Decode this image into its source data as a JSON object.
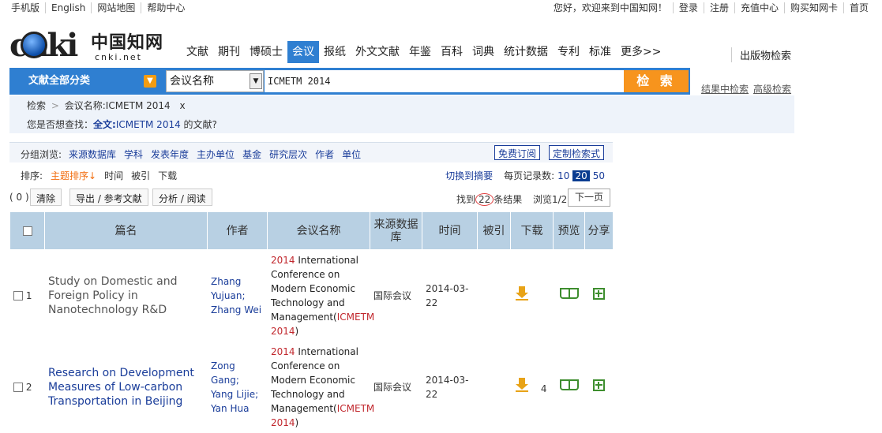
{
  "topbar": {
    "left": [
      "手机版",
      "English",
      "网站地图",
      "帮助中心"
    ],
    "right": [
      "您好，欢迎来到中国知网！",
      "登录",
      "注册",
      "充值中心",
      "购买知网卡",
      "首页"
    ]
  },
  "logo": {
    "text": "cnki",
    "cn": "中国知网",
    "net": "cnki.net"
  },
  "nav": {
    "items": [
      "文献",
      "期刊",
      "博硕士",
      "会议",
      "报纸",
      "外文文献",
      "年鉴",
      "百科",
      "词典",
      "统计数据",
      "专利",
      "标准",
      "更多>>"
    ],
    "active": "会议",
    "pub_search": "出版物检索"
  },
  "search": {
    "category": "文献全部分类",
    "field": "会议名称",
    "query": "ICMETM 2014",
    "button": "检 索",
    "in_results": "结果中检索",
    "advanced": "高级检索"
  },
  "crumb": {
    "root": "检索",
    "sep": ">",
    "term": "会议名称:ICMETM 2014",
    "close": "x"
  },
  "suggest": {
    "prefix": "您是否想查找：",
    "field": "全文:",
    "term": "ICMETM 2014",
    "suffix": " 的文献?"
  },
  "group": {
    "label": "分组浏览:",
    "items": [
      "来源数据库",
      "学科",
      "发表年度",
      "主办单位",
      "基金",
      "研究层次",
      "作者",
      "单位"
    ],
    "free_sub": "免费订阅",
    "custom": "定制检索式"
  },
  "sort": {
    "label": "排序:",
    "items": [
      "主题排序↓",
      "时间",
      "被引",
      "下载"
    ],
    "switch": "切换到摘要",
    "per_page_label": "每页记录数:",
    "per_page": [
      "10",
      "20",
      "50"
    ],
    "per_page_active": "20"
  },
  "tools": {
    "count": "( 0 )",
    "clear": "清除",
    "export": "导出 / 参考文献",
    "analyze": "分析 / 阅读",
    "found_prefix": "找到",
    "found_num": "22",
    "found_suffix": "条结果",
    "browse": "浏览1/2",
    "next": "下一页"
  },
  "table": {
    "headers": [
      "篇名",
      "作者",
      "会议名称",
      "来源数据库",
      "时间",
      "被引",
      "下载",
      "预览",
      "分享"
    ],
    "rows": [
      {
        "num": "1",
        "title": "Study on Domestic and Foreign Policy in Nanotechnology R&D",
        "authors": "Zhang Yujuan; Zhang Wei",
        "conf_year": "2014",
        "conf_mid": " International Conference on Modern Economic Technology and Management(",
        "conf_tag": "ICMETM 2014",
        "conf_end": ")",
        "source": "国际会议",
        "date": "2014-03-22",
        "cited": "",
        "downloads": ""
      },
      {
        "num": "2",
        "title": "Research on Development Measures of Low-carbon Transportation in Beijing",
        "authors": "Zong Gang; Yang Lijie; Yan Hua",
        "conf_year": "2014",
        "conf_mid": " International Conference on Modern Economic Technology and Management(",
        "conf_tag": "ICMETM 2014",
        "conf_end": ")",
        "source": "国际会议",
        "date": "2014-03-22",
        "cited": "",
        "downloads": "4"
      }
    ]
  }
}
